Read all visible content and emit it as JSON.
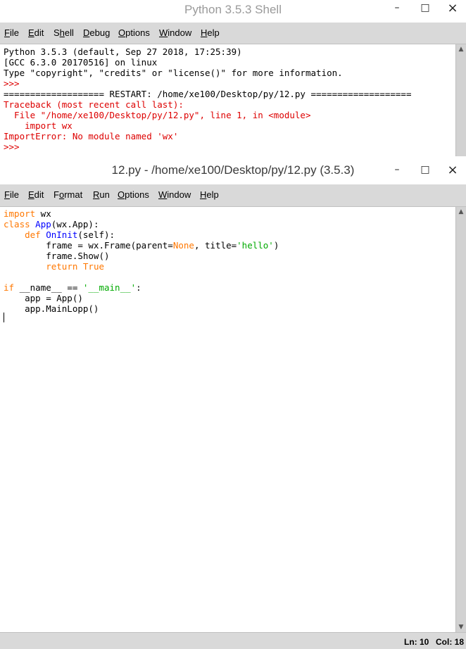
{
  "shell": {
    "title": "Python 3.5.3 Shell",
    "menu": [
      {
        "label": "File",
        "u": "F",
        "rest": "ile"
      },
      {
        "label": "Edit",
        "u": "E",
        "rest": "dit"
      },
      {
        "label": "Shell",
        "pre": "S",
        "u": "h",
        "rest": "ell"
      },
      {
        "label": "Debug",
        "u": "D",
        "rest": "ebug"
      },
      {
        "label": "Options",
        "u": "O",
        "rest": "ptions"
      },
      {
        "label": "Window",
        "u": "W",
        "rest": "indow"
      },
      {
        "label": "Help",
        "u": "H",
        "rest": "elp"
      }
    ],
    "lines": [
      {
        "text": "Python 3.5.3 (default, Sep 27 2018, 17:25:39)",
        "color": "black"
      },
      {
        "text": "[GCC 6.3.0 20170516] on linux",
        "color": "black"
      },
      {
        "text": "Type \"copyright\", \"credits\" or \"license()\" for more information.",
        "color": "black"
      },
      {
        "text": ">>> ",
        "color": "red"
      },
      {
        "text": "=================== RESTART: /home/xe100/Desktop/py/12.py ===================",
        "color": "black"
      },
      {
        "text": "Traceback (most recent call last):",
        "color": "red"
      },
      {
        "text": "  File \"/home/xe100/Desktop/py/12.py\", line 1, in <module>",
        "color": "red"
      },
      {
        "text": "    import wx",
        "color": "red"
      },
      {
        "text": "ImportError: No module named 'wx'",
        "color": "red"
      },
      {
        "text": ">>> ",
        "color": "red"
      }
    ]
  },
  "editor": {
    "title": "12.py - /home/xe100/Desktop/py/12.py (3.5.3)",
    "menu": [
      {
        "label": "File",
        "u": "F",
        "rest": "ile"
      },
      {
        "label": "Edit",
        "u": "E",
        "rest": "dit"
      },
      {
        "label": "Format",
        "pre": "F",
        "u": "o",
        "rest": "rmat"
      },
      {
        "label": "Run",
        "u": "R",
        "rest": "un"
      },
      {
        "label": "Options",
        "u": "O",
        "rest": "ptions"
      },
      {
        "label": "Window",
        "u": "W",
        "rest": "indow"
      },
      {
        "label": "Help",
        "u": "H",
        "rest": "elp"
      }
    ],
    "code": [
      [
        {
          "t": "import",
          "c": "kw"
        },
        {
          "t": " wx",
          "c": "black"
        }
      ],
      [
        {
          "t": "class",
          "c": "kw"
        },
        {
          "t": " ",
          "c": "black"
        },
        {
          "t": "App",
          "c": "def"
        },
        {
          "t": "(wx.App):",
          "c": "black"
        }
      ],
      [
        {
          "t": "    ",
          "c": "black"
        },
        {
          "t": "def",
          "c": "kw"
        },
        {
          "t": " ",
          "c": "black"
        },
        {
          "t": "OnInit",
          "c": "def"
        },
        {
          "t": "(self):",
          "c": "black"
        }
      ],
      [
        {
          "t": "        frame = wx.Frame(parent=",
          "c": "black"
        },
        {
          "t": "None",
          "c": "kw"
        },
        {
          "t": ", title=",
          "c": "black"
        },
        {
          "t": "'hello'",
          "c": "str"
        },
        {
          "t": ")",
          "c": "black"
        }
      ],
      [
        {
          "t": "        frame.Show()",
          "c": "black"
        }
      ],
      [
        {
          "t": "        ",
          "c": "black"
        },
        {
          "t": "return",
          "c": "kw"
        },
        {
          "t": " ",
          "c": "black"
        },
        {
          "t": "True",
          "c": "kw"
        }
      ],
      [],
      [
        {
          "t": "if",
          "c": "kw"
        },
        {
          "t": " __name__ == ",
          "c": "black"
        },
        {
          "t": "'__main__'",
          "c": "str"
        },
        {
          "t": ":",
          "c": "black"
        }
      ],
      [
        {
          "t": "    app = App()",
          "c": "black"
        }
      ],
      [
        {
          "t": "    app.MainLopp()",
          "c": "black"
        }
      ]
    ],
    "status": {
      "ln": "Ln: 10",
      "col": "Col: 18"
    }
  },
  "window_controls": {
    "minimize": "–",
    "maximize": "□",
    "close": "×"
  }
}
